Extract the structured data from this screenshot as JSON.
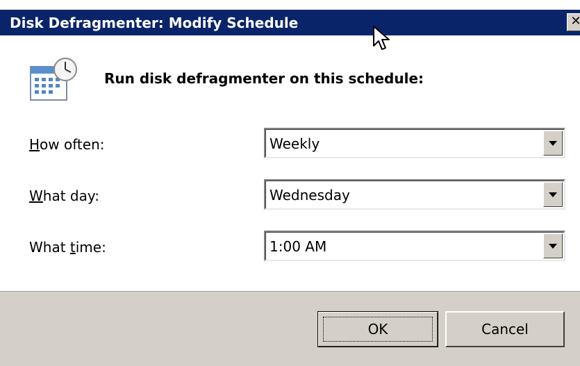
{
  "window": {
    "title": "Disk Defragmenter: Modify Schedule",
    "close_label": "✕"
  },
  "headline": "Run disk defragmenter on this schedule:",
  "fields": {
    "how_often": {
      "label_mnemonic": "H",
      "label_rest": "ow often:",
      "value": "Weekly"
    },
    "what_day": {
      "label_mnemonic": "W",
      "label_rest": "hat day:",
      "value": "Wednesday"
    },
    "what_time": {
      "label_before": "What ",
      "label_mnemonic": "t",
      "label_rest": "ime:",
      "value": "1:00 AM"
    }
  },
  "buttons": {
    "ok_label": "OK",
    "cancel_label": "Cancel"
  },
  "icons": {
    "schedule": "calendar-clock-icon",
    "cursor": "mouse-pointer-icon"
  },
  "colors": {
    "titlebar": "#0a246a",
    "dialog_face": "#d4d0c8"
  }
}
